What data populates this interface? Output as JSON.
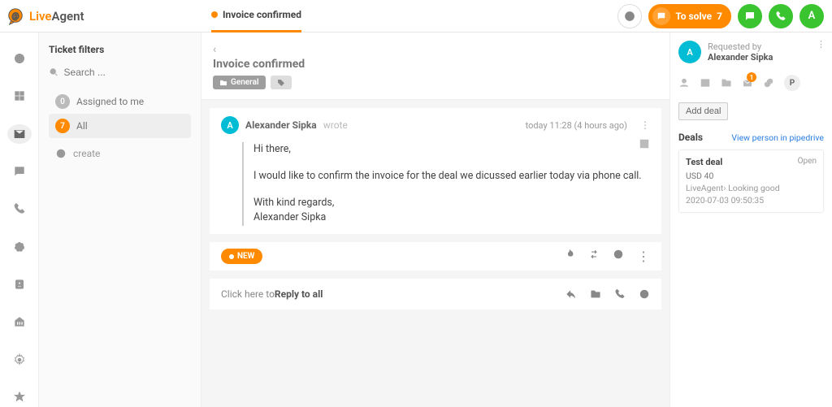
{
  "brand": {
    "name_a": "Live",
    "name_b": "Agent"
  },
  "tab": {
    "title": "Invoice confirmed"
  },
  "topbar": {
    "to_solve_label": "To solve",
    "to_solve_count": "7",
    "avatar_initial": "A"
  },
  "nav": {
    "active_index": 2
  },
  "filters": {
    "title": "Ticket filters",
    "search_placeholder": "Search ...",
    "items": [
      {
        "count": "0",
        "label": "Assigned to me"
      },
      {
        "count": "7",
        "label": "All"
      }
    ],
    "create_label": "create"
  },
  "ticket": {
    "title": "Invoice confirmed",
    "tag": "General"
  },
  "message": {
    "avatar_initial": "A",
    "author": "Alexander Sipka",
    "wrote_label": "wrote",
    "time": "today 11:28 (4 hours ago)",
    "greeting": "Hi there,",
    "body": "I would like to confirm the invoice for the deal we dicussed earlier today via phone call.",
    "signoff": "With kind regards,",
    "signature": "Alexander Sipka"
  },
  "status_chip": "NEW",
  "reply": {
    "prefix": "Click here to ",
    "bold": "Reply to all"
  },
  "details": {
    "requested_by_label": "Requested by",
    "requester_name": "Alexander Sipka",
    "avatar_initial": "A",
    "deals_badge": "1",
    "pipedrive_initial": "P",
    "add_deal_label": "Add deal",
    "deals_title": "Deals",
    "view_link": "View person in pipedrive",
    "deal": {
      "name": "Test deal",
      "price": "USD 40",
      "stage": "LiveAgent› Looking good",
      "date": "2020-07-03 09:50:35",
      "status": "Open"
    }
  }
}
